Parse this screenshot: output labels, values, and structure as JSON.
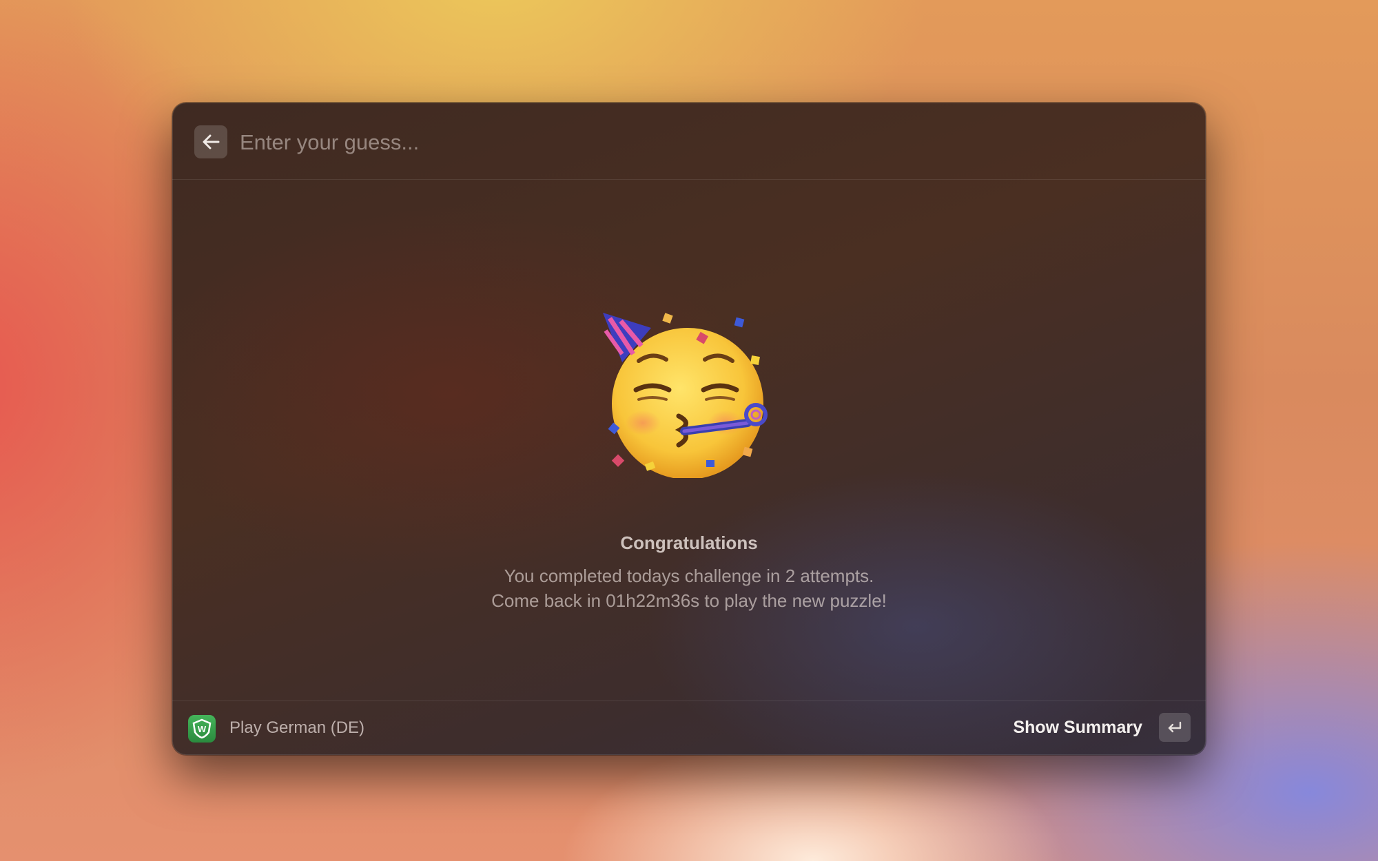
{
  "search": {
    "placeholder": "Enter your guess..."
  },
  "icons": {
    "back": "arrow-left-icon",
    "celebration": "partying-face-icon",
    "app": "wordle-shield-icon",
    "enter": "return-key-icon"
  },
  "result": {
    "title": "Congratulations",
    "line1": "You completed todays challenge in 2 attempts.",
    "line2": "Come back in 01h22m36s to play the new puzzle!"
  },
  "footer": {
    "app_letter": "W",
    "action_label": "Play German (DE)",
    "primary_action": "Show Summary"
  },
  "colors": {
    "app_icon": "#3aa04d",
    "window_bg": "#43291f"
  }
}
